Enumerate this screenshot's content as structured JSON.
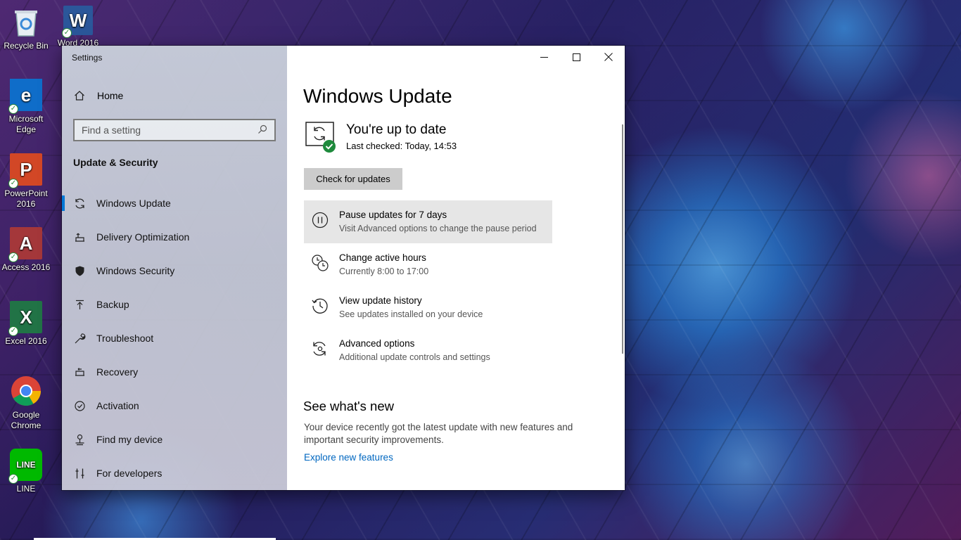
{
  "desktop": {
    "icons": [
      {
        "label": "Recycle Bin",
        "icon": "recycle-bin-icon"
      },
      {
        "label": "Word 2016",
        "icon": "word-icon"
      },
      {
        "label": "Microsoft Edge",
        "icon": "edge-icon"
      },
      {
        "label": "PowerPoint 2016",
        "icon": "powerpoint-icon"
      },
      {
        "label": "Access 2016",
        "icon": "access-icon"
      },
      {
        "label": "Excel 2016",
        "icon": "excel-icon"
      },
      {
        "label": "Google Chrome",
        "icon": "chrome-icon"
      },
      {
        "label": "LINE",
        "icon": "line-icon"
      }
    ]
  },
  "window": {
    "title": "Settings",
    "caption": {
      "minimize": "—",
      "maximize": "☐",
      "close": "✕"
    }
  },
  "sidebar": {
    "home_label": "Home",
    "search_placeholder": "Find a setting",
    "section_title": "Update & Security",
    "items": [
      {
        "label": "Windows Update",
        "icon": "refresh-icon",
        "active": true
      },
      {
        "label": "Delivery Optimization",
        "icon": "delivery-optimization-icon"
      },
      {
        "label": "Windows Security",
        "icon": "shield-icon"
      },
      {
        "label": "Backup",
        "icon": "backup-icon"
      },
      {
        "label": "Troubleshoot",
        "icon": "wrench-icon"
      },
      {
        "label": "Recovery",
        "icon": "recovery-icon"
      },
      {
        "label": "Activation",
        "icon": "activation-icon"
      },
      {
        "label": "Find my device",
        "icon": "find-device-icon"
      },
      {
        "label": "For developers",
        "icon": "developer-icon"
      }
    ]
  },
  "main": {
    "title": "Windows Update",
    "status_title": "You're up to date",
    "status_sub": "Last checked: Today, 14:53",
    "check_button": "Check for updates",
    "options": [
      {
        "title": "Pause updates for 7 days",
        "sub": "Visit Advanced options to change the pause period",
        "icon": "pause-icon"
      },
      {
        "title": "Change active hours",
        "sub": "Currently 8:00 to 17:00",
        "icon": "active-hours-icon"
      },
      {
        "title": "View update history",
        "sub": "See updates installed on your device",
        "icon": "history-icon"
      },
      {
        "title": "Advanced options",
        "sub": "Additional update controls and settings",
        "icon": "advanced-options-icon"
      }
    ],
    "whats_new_title": "See what's new",
    "whats_new_desc": "Your device recently got the latest update with new features and important security improvements.",
    "whats_new_link": "Explore new features"
  },
  "colors": {
    "accent": "#0078d7",
    "link": "#0067c0",
    "success": "#1e8a3c"
  }
}
